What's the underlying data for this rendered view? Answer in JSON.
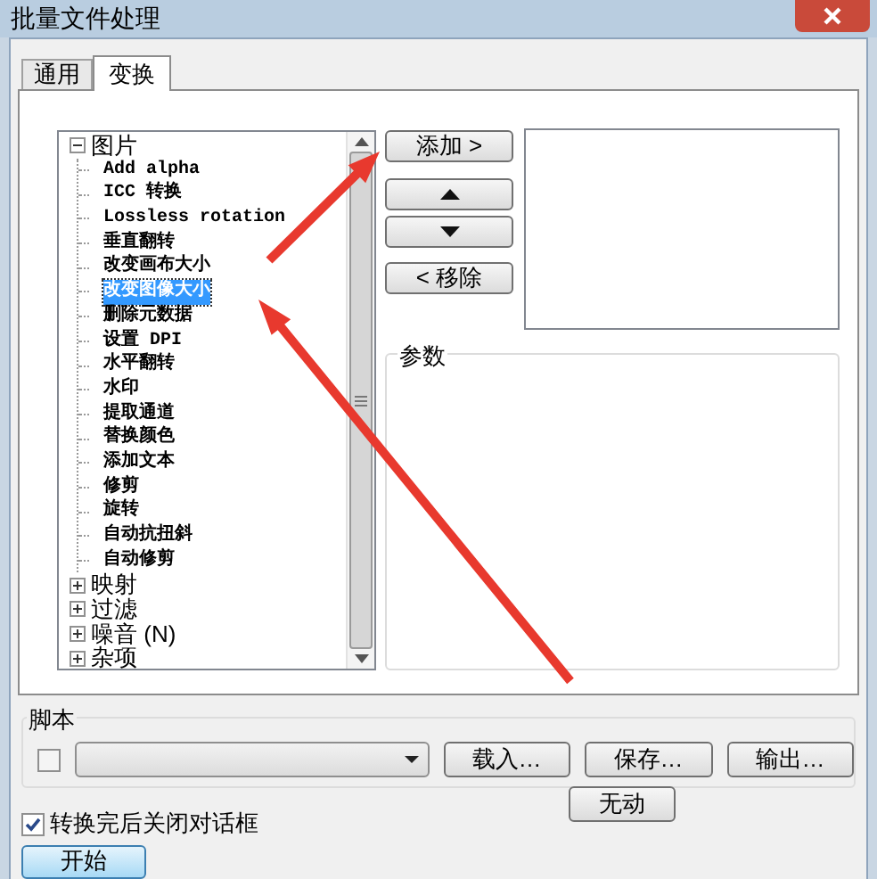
{
  "window": {
    "title": "批量文件处理"
  },
  "tabs": [
    {
      "label": "通用",
      "selected": false
    },
    {
      "label": "变换",
      "selected": true
    }
  ],
  "tree": [
    {
      "label": "图片",
      "expanded": true,
      "children": [
        {
          "label": "Add alpha",
          "selected": false
        },
        {
          "label": "ICC 转换",
          "selected": false
        },
        {
          "label": "Lossless rotation",
          "selected": false
        },
        {
          "label": "垂直翻转",
          "selected": false
        },
        {
          "label": "改变画布大小",
          "selected": false
        },
        {
          "label": "改变图像大小",
          "selected": true
        },
        {
          "label": "删除元数据",
          "selected": false
        },
        {
          "label": "设置 DPI",
          "selected": false
        },
        {
          "label": "水平翻转",
          "selected": false
        },
        {
          "label": "水印",
          "selected": false
        },
        {
          "label": "提取通道",
          "selected": false
        },
        {
          "label": "替换颜色",
          "selected": false
        },
        {
          "label": "添加文本",
          "selected": false
        },
        {
          "label": "修剪",
          "selected": false
        },
        {
          "label": "旋转",
          "selected": false
        },
        {
          "label": "自动抗扭斜",
          "selected": false
        },
        {
          "label": "自动修剪",
          "selected": false
        }
      ]
    },
    {
      "label": "映射",
      "expanded": false
    },
    {
      "label": "过滤",
      "expanded": false
    },
    {
      "label": "噪音 (N)",
      "expanded": false
    },
    {
      "label": "杂项",
      "expanded": false
    }
  ],
  "side_buttons": [
    {
      "kind": "text",
      "label": "添加 >"
    },
    {
      "kind": "up"
    },
    {
      "kind": "down"
    },
    {
      "kind": "text",
      "label": "< 移除"
    }
  ],
  "params": {
    "title": "参数"
  },
  "script": {
    "title": "脚本",
    "enabled": false,
    "buttons": [
      "载入…",
      "保存…",
      "输出…"
    ]
  },
  "close_after": {
    "label": "转换完后关闭对话框",
    "checked": true
  },
  "buttons": [
    {
      "label": "无动",
      "focused": false
    },
    {
      "label": "开始",
      "focused": true
    }
  ]
}
